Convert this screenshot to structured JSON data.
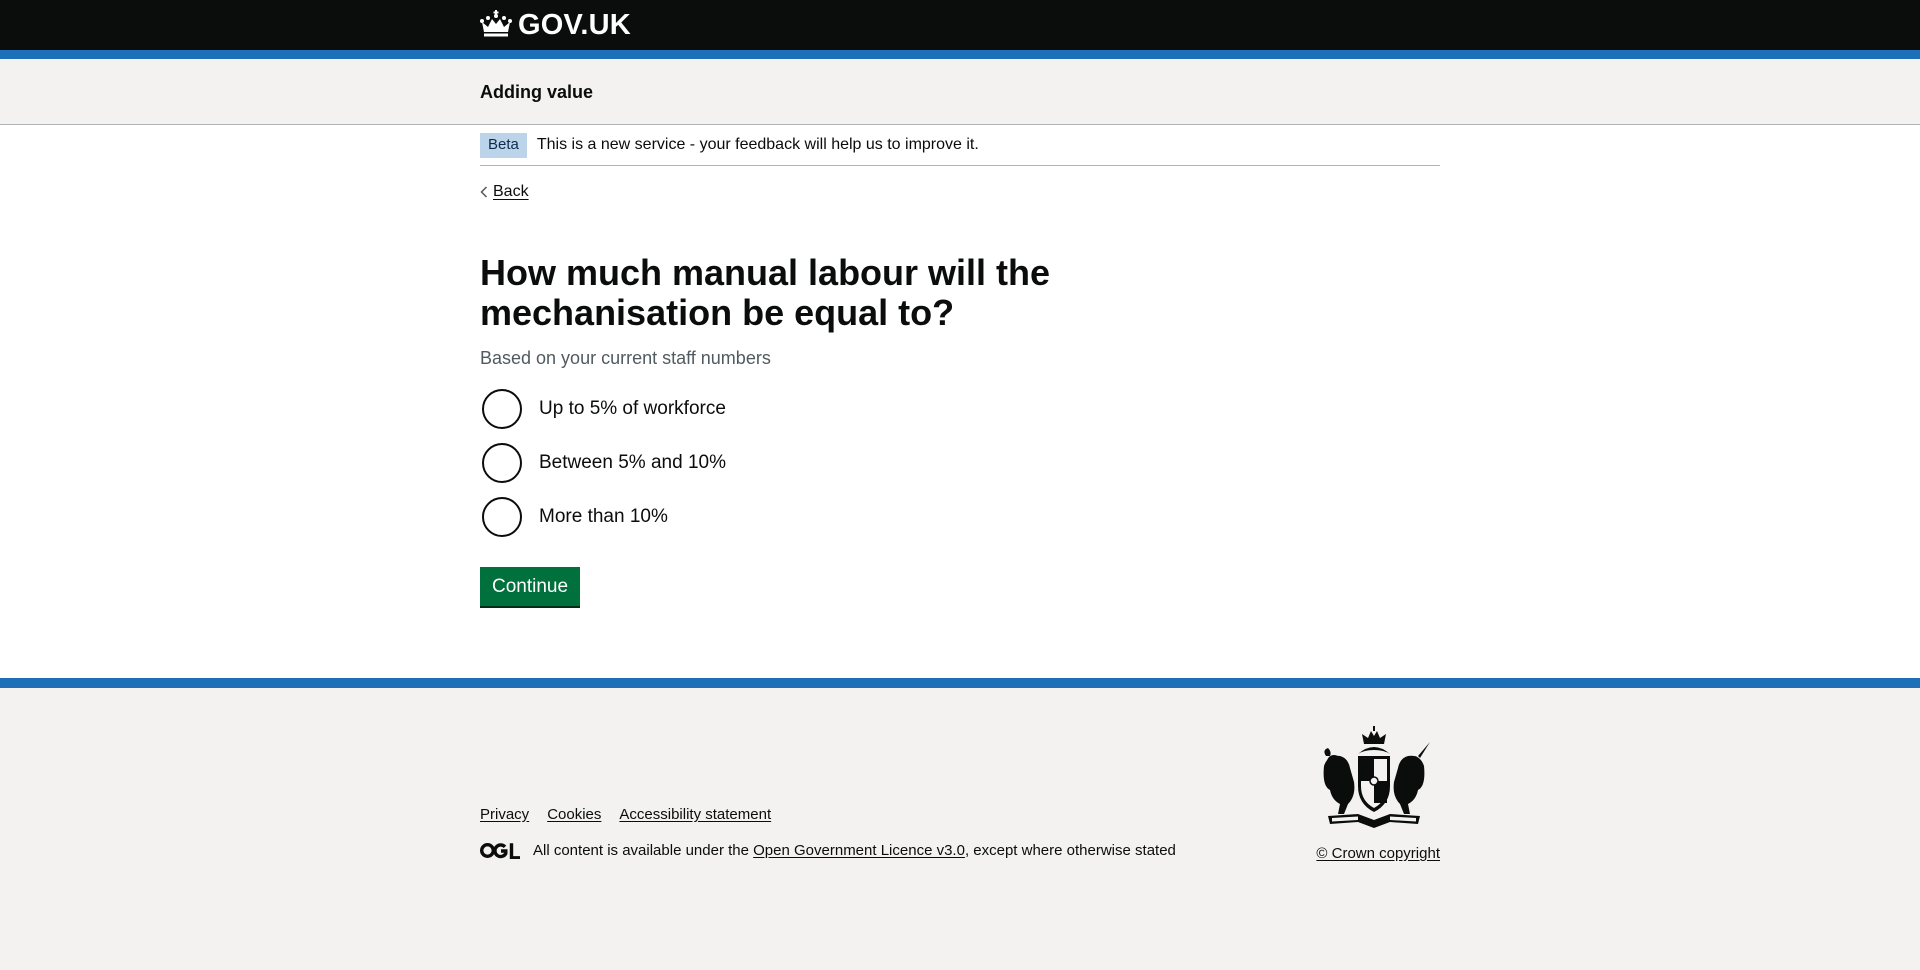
{
  "header": {
    "logotype": "GOV.UK",
    "icon": "crown-icon"
  },
  "service": {
    "name": "Adding value"
  },
  "phase_banner": {
    "tag": "Beta",
    "text": "This is a new service - your feedback will help us to improve it."
  },
  "back_link": {
    "label": "Back",
    "icon": "chevron-left-icon"
  },
  "question": {
    "title": "How much manual labour will the mechanisation be equal to?",
    "hint": "Based on your current staff numbers",
    "options": [
      {
        "label": "Up to 5% of workforce",
        "selected": false
      },
      {
        "label": "Between 5% and 10%",
        "selected": false
      },
      {
        "label": "More than 10%",
        "selected": false
      }
    ]
  },
  "actions": {
    "continue_label": "Continue"
  },
  "footer": {
    "links": [
      "Privacy",
      "Cookies",
      "Accessibility statement"
    ],
    "licence_prefix": "All content is available under the ",
    "licence_link": "Open Government Licence v3.0",
    "licence_suffix": ", except where otherwise stated",
    "copyright": "© Crown copyright",
    "ogl_icon": "ogl-logo-icon",
    "crest_icon": "royal-coat-of-arms-icon"
  },
  "colors": {
    "header_bg": "#0b0c0c",
    "brand_blue": "#1d70b8",
    "button_green": "#00703c",
    "footer_bg": "#f3f2f1",
    "beta_tag_bg": "#bbd4ea"
  }
}
